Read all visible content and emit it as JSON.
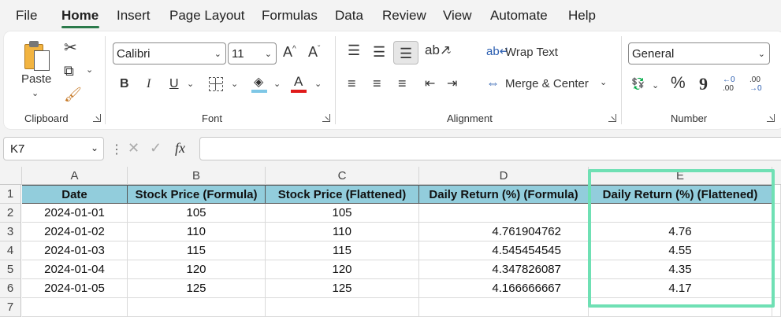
{
  "menu": [
    "File",
    "Home",
    "Insert",
    "Page Layout",
    "Formulas",
    "Data",
    "Review",
    "View",
    "Automate",
    "Help"
  ],
  "ribbon": {
    "clipboard": {
      "paste_label": "Paste",
      "group_label": "Clipboard"
    },
    "font": {
      "family": "Calibri",
      "size": "11",
      "group_label": "Font",
      "bold": "B",
      "italic": "I",
      "underline": "U",
      "grow": "A^",
      "shrink": "Aˇ",
      "color_letter": "A"
    },
    "alignment": {
      "wrap_text": "Wrap Text",
      "merge_center": "Merge & Center",
      "group_label": "Alignment"
    },
    "number": {
      "format": "General",
      "percent": "%",
      "comma": "9",
      "increase_decimal": "←0 .00",
      "decrease_decimal": ".00 →0",
      "group_label": "Number"
    }
  },
  "formula_bar": {
    "name_box": "K7",
    "fx": "fx",
    "value": ""
  },
  "columns": [
    "A",
    "B",
    "C",
    "D",
    "E"
  ],
  "rows": [
    "1",
    "2",
    "3",
    "4",
    "5",
    "6",
    "7"
  ],
  "table": {
    "headers": [
      "Date",
      "Stock Price (Formula)",
      "Stock Price (Flattened)",
      "Daily Return (%) (Formula)",
      "Daily Return (%) (Flattened)"
    ],
    "data": [
      [
        "2024-01-01",
        "105",
        "105",
        "",
        ""
      ],
      [
        "2024-01-02",
        "110",
        "110",
        "4.761904762",
        "4.76"
      ],
      [
        "2024-01-03",
        "115",
        "115",
        "4.545454545",
        "4.55"
      ],
      [
        "2024-01-04",
        "120",
        "120",
        "4.347826087",
        "4.35"
      ],
      [
        "2024-01-05",
        "125",
        "125",
        "4.166666667",
        "4.17"
      ]
    ]
  },
  "colors": {
    "header_fill": "#92cddc",
    "highlight": "#6fe0b4",
    "accent": "#2b7a4b"
  }
}
